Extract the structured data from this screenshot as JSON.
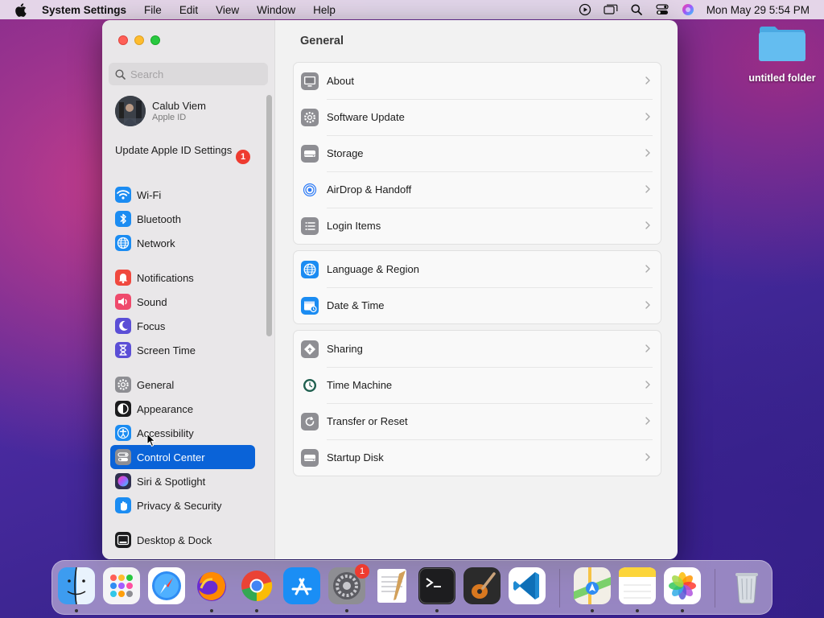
{
  "menubar": {
    "app_name": "System Settings",
    "menus": [
      "File",
      "Edit",
      "View",
      "Window",
      "Help"
    ],
    "clock": "Mon May 29  5:54 PM"
  },
  "desktop": {
    "folder_label": "untitled folder"
  },
  "window": {
    "sidebar": {
      "search_placeholder": "Search",
      "profile": {
        "name": "Calub Viem",
        "subtitle": "Apple ID"
      },
      "update": {
        "label": "Update Apple ID Settings",
        "badge": "1"
      },
      "items": [
        {
          "label": "Wi-Fi",
          "icon": "wifi-icon",
          "color": "#1b8cf2"
        },
        {
          "label": "Bluetooth",
          "icon": "bluetooth-icon",
          "color": "#1b8cf2"
        },
        {
          "label": "Network",
          "icon": "globe-icon",
          "color": "#1b8cf2"
        },
        {
          "label": "Notifications",
          "icon": "bell-icon",
          "color": "#f0483e"
        },
        {
          "label": "Sound",
          "icon": "speaker-icon",
          "color": "#ef4a6c"
        },
        {
          "label": "Focus",
          "icon": "moon-icon",
          "color": "#5b4ed6"
        },
        {
          "label": "Screen Time",
          "icon": "hourglass-icon",
          "color": "#5b4ed6"
        },
        {
          "label": "General",
          "icon": "gear-icon",
          "color": "#8e8e93"
        },
        {
          "label": "Appearance",
          "icon": "appearance-icon",
          "color": "#1c1c1e"
        },
        {
          "label": "Accessibility",
          "icon": "accessibility-icon",
          "color": "#1b8cf2"
        },
        {
          "label": "Control Center",
          "icon": "control-center-icon",
          "color": "#8e8e93"
        },
        {
          "label": "Siri & Spotlight",
          "icon": "siri-icon",
          "color": "#2f2f4f"
        },
        {
          "label": "Privacy & Security",
          "icon": "hand-icon",
          "color": "#1b8cf2"
        },
        {
          "label": "Desktop & Dock",
          "icon": "dock-icon",
          "color": "#1c1c1e"
        }
      ],
      "selected": "Control Center"
    },
    "main": {
      "title": "General",
      "groups": [
        [
          {
            "label": "About",
            "icon": "monitor-icon"
          },
          {
            "label": "Software Update",
            "icon": "gear-badge-icon"
          },
          {
            "label": "Storage",
            "icon": "drive-icon"
          },
          {
            "label": "AirDrop & Handoff",
            "icon": "airdrop-icon"
          },
          {
            "label": "Login Items",
            "icon": "list-icon"
          }
        ],
        [
          {
            "label": "Language & Region",
            "icon": "globe-icon"
          },
          {
            "label": "Date & Time",
            "icon": "calendar-clock-icon"
          }
        ],
        [
          {
            "label": "Sharing",
            "icon": "sharing-icon"
          },
          {
            "label": "Time Machine",
            "icon": "time-machine-icon"
          },
          {
            "label": "Transfer or Reset",
            "icon": "reset-icon"
          },
          {
            "label": "Startup Disk",
            "icon": "drive-icon"
          }
        ]
      ]
    }
  },
  "dock": {
    "apps": [
      {
        "name": "finder-app",
        "running": true
      },
      {
        "name": "launchpad-app",
        "running": false
      },
      {
        "name": "safari-app",
        "running": false
      },
      {
        "name": "firefox-app",
        "running": true
      },
      {
        "name": "chrome-app",
        "running": true
      },
      {
        "name": "app-store-app",
        "running": false
      },
      {
        "name": "system-settings-app",
        "running": true,
        "badge": "1"
      },
      {
        "name": "textedit-app",
        "running": false
      },
      {
        "name": "terminal-app",
        "running": true
      },
      {
        "name": "garageband-app",
        "running": false
      },
      {
        "name": "vscode-app",
        "running": false
      },
      {
        "name": "maps-app",
        "running": true
      },
      {
        "name": "notes-app",
        "running": true
      },
      {
        "name": "photos-app",
        "running": true
      },
      {
        "name": "trash-app",
        "running": false
      }
    ]
  }
}
